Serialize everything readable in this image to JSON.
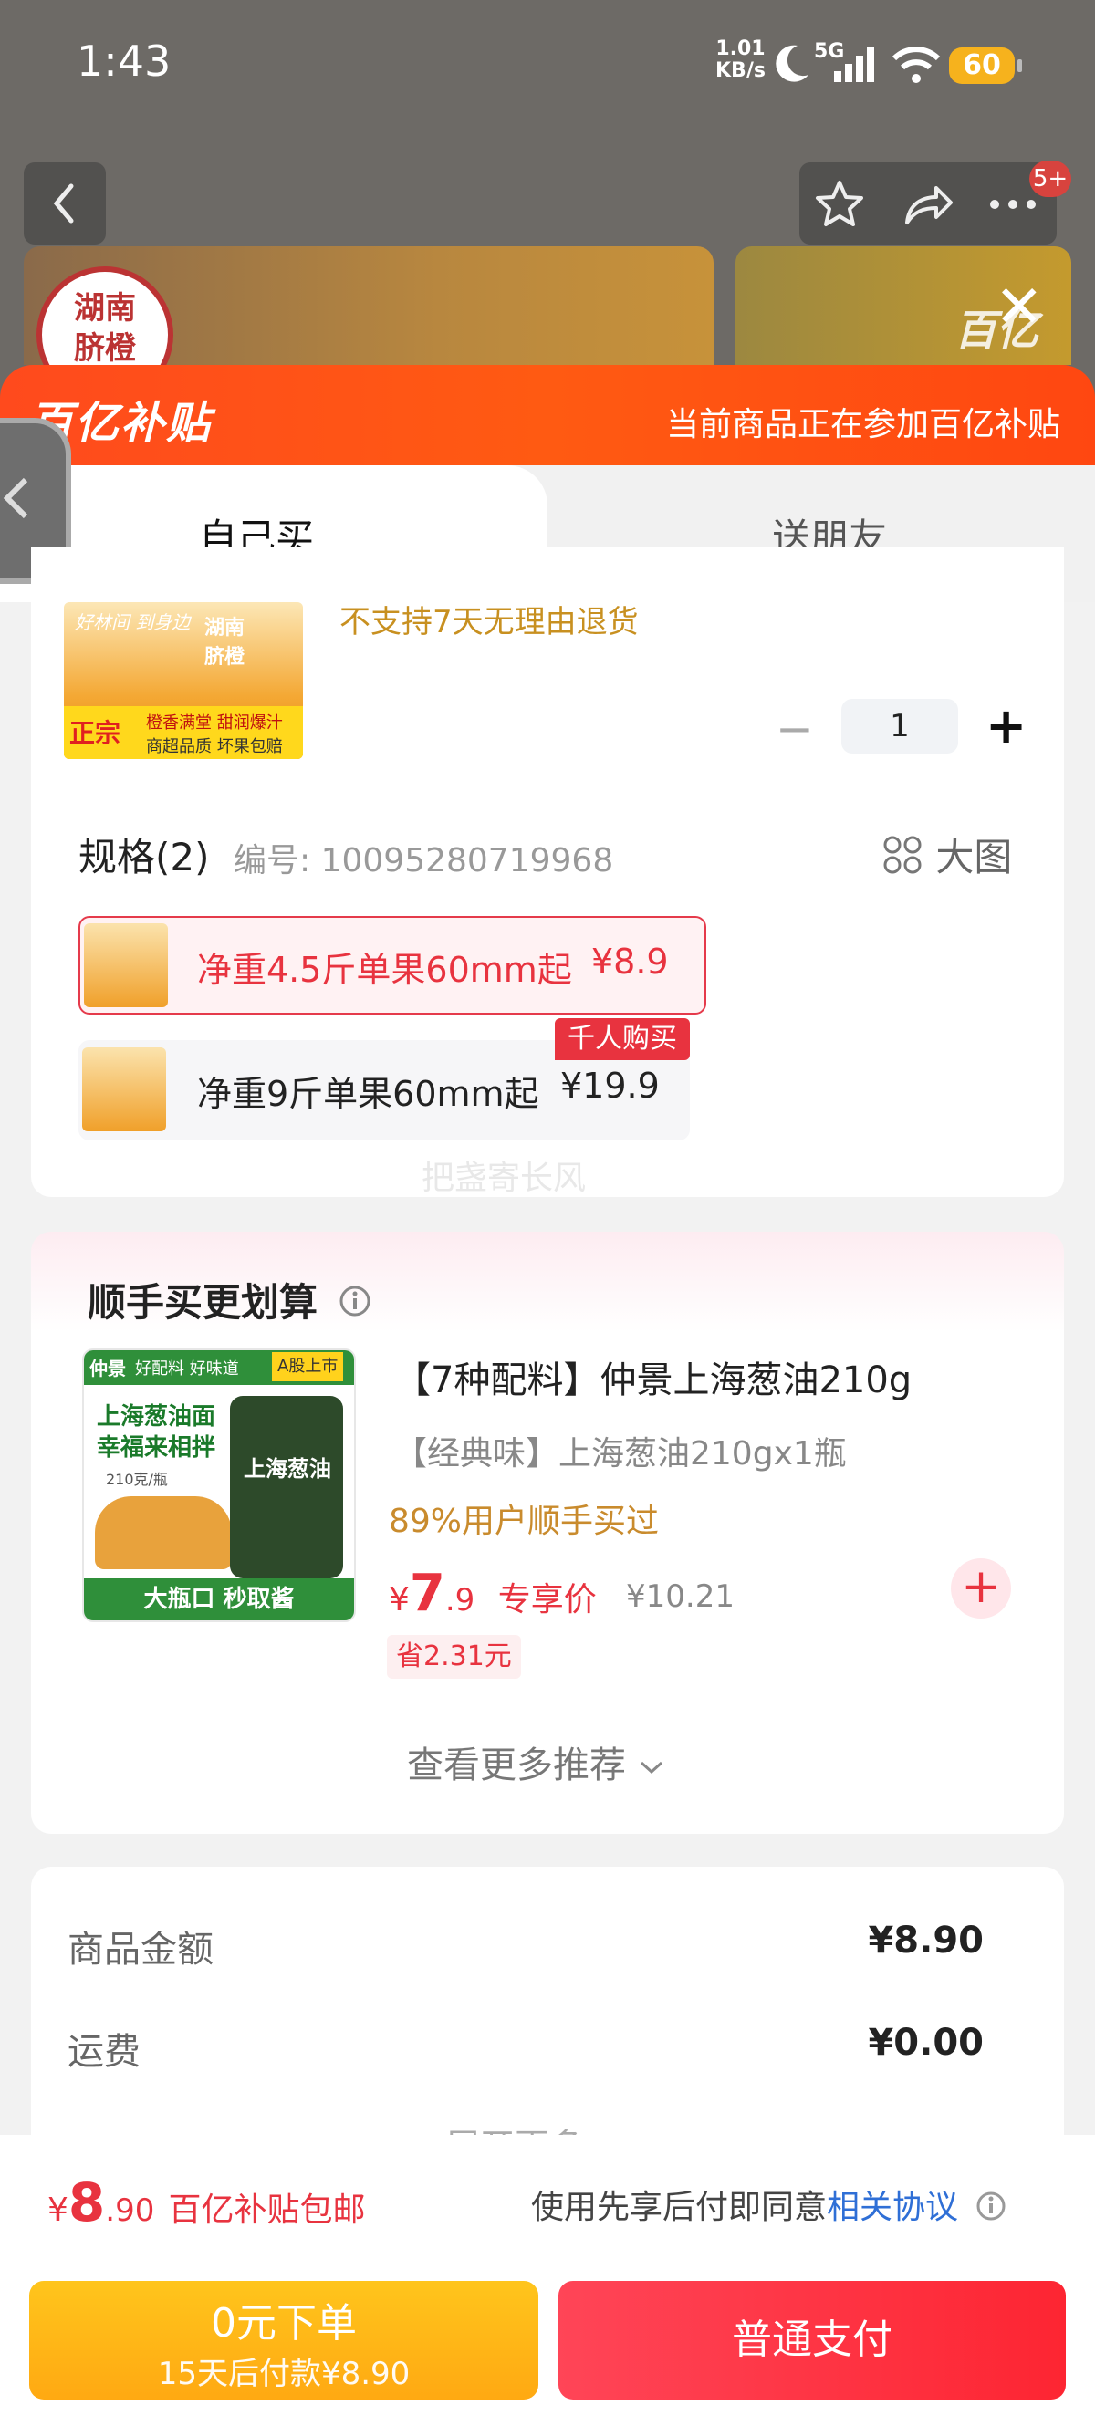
{
  "status_bar": {
    "time": "1:43",
    "speed_value": "1.01",
    "speed_unit": "KB/s",
    "network": "5G",
    "battery": "60"
  },
  "product_page": {
    "notification_count": "5+",
    "seal_text_line1": "湖南",
    "seal_text_line2": "脐橙",
    "watermark_logo": "百亿"
  },
  "subsidy_banner": {
    "logo": "百亿补贴",
    "note": "当前商品正在参加百亿补贴"
  },
  "tabs": [
    {
      "label": "自己买",
      "active": true
    },
    {
      "label": "送朋友",
      "active": false
    }
  ],
  "product": {
    "img_text_top": "好林间 到身边",
    "img_text_brand": "湖南 脐橙",
    "img_tag1": "正宗",
    "img_tag2": "橙香满堂 甜润爆汁",
    "img_tag3": "商超品质 坏果包赔",
    "return_policy": "不支持7天无理由退货",
    "quantity": "1"
  },
  "spec": {
    "title": "规格(2)",
    "code": "编号: 10095280719968",
    "big_image_label": "大图",
    "options": [
      {
        "name": "净重4.5斤单果60mm起",
        "price": "¥8.9",
        "selected": true
      },
      {
        "name": "净重9斤单果60mm起",
        "price": "¥19.9",
        "selected": false,
        "tag": "千人购买"
      }
    ],
    "watermark": "把盏寄长风"
  },
  "upsell": {
    "title": "顺手买更划算",
    "image_badge_left": "仲景",
    "image_badge_mid": "好配料 好味道",
    "image_badge_right": "A股上市",
    "image_text": "上海葱油面 幸福来相拌",
    "image_weight": "210克/瓶",
    "image_jar_label": "上海葱油",
    "image_footer": "大瓶口 秒取酱",
    "name": "【7种配料】仲景上海葱油210g",
    "desc": "【经典味】上海葱油210gx1瓶",
    "bought": "89%用户顺手买过",
    "price_symbol": "¥",
    "price_int": "7",
    "price_dec": ".9",
    "price_label": "专享价",
    "old_price": "¥10.21",
    "save": "省2.31元",
    "see_more": "查看更多推荐"
  },
  "summary": [
    {
      "label": "商品金额",
      "value": "¥8.90"
    },
    {
      "label": "运费",
      "value": "¥0.00"
    }
  ],
  "summary_cut": "展开更多",
  "footer": {
    "price_symbol": "¥",
    "price_int": "8",
    "price_dec": ".90",
    "price_note": "百亿补贴包邮",
    "agreement_prefix": "使用先享后付即同意",
    "agreement_link": "相关协议",
    "btn_zero_title": "0元下单",
    "btn_zero_sub": "15天后付款¥8.90",
    "btn_pay": "普通支付"
  },
  "colors": {
    "accent": "#e8333f",
    "subsidy": "#ff4e16",
    "gold": "#c98b2d",
    "yellow": "#ffb817"
  }
}
